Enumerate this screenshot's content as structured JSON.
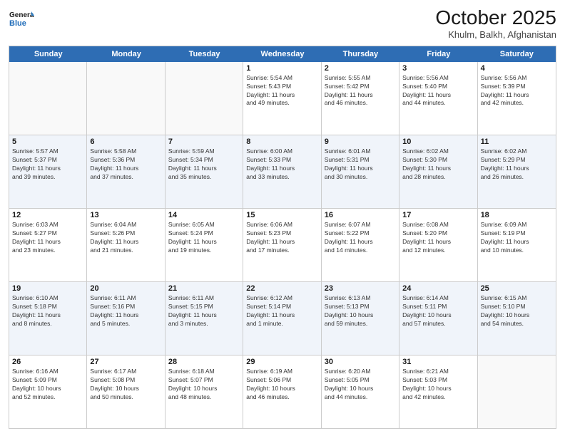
{
  "header": {
    "logo_line1": "General",
    "logo_line2": "Blue",
    "month_title": "October 2025",
    "location": "Khulm, Balkh, Afghanistan"
  },
  "day_names": [
    "Sunday",
    "Monday",
    "Tuesday",
    "Wednesday",
    "Thursday",
    "Friday",
    "Saturday"
  ],
  "weeks": [
    [
      {
        "num": "",
        "info": ""
      },
      {
        "num": "",
        "info": ""
      },
      {
        "num": "",
        "info": ""
      },
      {
        "num": "1",
        "info": "Sunrise: 5:54 AM\nSunset: 5:43 PM\nDaylight: 11 hours\nand 49 minutes."
      },
      {
        "num": "2",
        "info": "Sunrise: 5:55 AM\nSunset: 5:42 PM\nDaylight: 11 hours\nand 46 minutes."
      },
      {
        "num": "3",
        "info": "Sunrise: 5:56 AM\nSunset: 5:40 PM\nDaylight: 11 hours\nand 44 minutes."
      },
      {
        "num": "4",
        "info": "Sunrise: 5:56 AM\nSunset: 5:39 PM\nDaylight: 11 hours\nand 42 minutes."
      }
    ],
    [
      {
        "num": "5",
        "info": "Sunrise: 5:57 AM\nSunset: 5:37 PM\nDaylight: 11 hours\nand 39 minutes."
      },
      {
        "num": "6",
        "info": "Sunrise: 5:58 AM\nSunset: 5:36 PM\nDaylight: 11 hours\nand 37 minutes."
      },
      {
        "num": "7",
        "info": "Sunrise: 5:59 AM\nSunset: 5:34 PM\nDaylight: 11 hours\nand 35 minutes."
      },
      {
        "num": "8",
        "info": "Sunrise: 6:00 AM\nSunset: 5:33 PM\nDaylight: 11 hours\nand 33 minutes."
      },
      {
        "num": "9",
        "info": "Sunrise: 6:01 AM\nSunset: 5:31 PM\nDaylight: 11 hours\nand 30 minutes."
      },
      {
        "num": "10",
        "info": "Sunrise: 6:02 AM\nSunset: 5:30 PM\nDaylight: 11 hours\nand 28 minutes."
      },
      {
        "num": "11",
        "info": "Sunrise: 6:02 AM\nSunset: 5:29 PM\nDaylight: 11 hours\nand 26 minutes."
      }
    ],
    [
      {
        "num": "12",
        "info": "Sunrise: 6:03 AM\nSunset: 5:27 PM\nDaylight: 11 hours\nand 23 minutes."
      },
      {
        "num": "13",
        "info": "Sunrise: 6:04 AM\nSunset: 5:26 PM\nDaylight: 11 hours\nand 21 minutes."
      },
      {
        "num": "14",
        "info": "Sunrise: 6:05 AM\nSunset: 5:24 PM\nDaylight: 11 hours\nand 19 minutes."
      },
      {
        "num": "15",
        "info": "Sunrise: 6:06 AM\nSunset: 5:23 PM\nDaylight: 11 hours\nand 17 minutes."
      },
      {
        "num": "16",
        "info": "Sunrise: 6:07 AM\nSunset: 5:22 PM\nDaylight: 11 hours\nand 14 minutes."
      },
      {
        "num": "17",
        "info": "Sunrise: 6:08 AM\nSunset: 5:20 PM\nDaylight: 11 hours\nand 12 minutes."
      },
      {
        "num": "18",
        "info": "Sunrise: 6:09 AM\nSunset: 5:19 PM\nDaylight: 11 hours\nand 10 minutes."
      }
    ],
    [
      {
        "num": "19",
        "info": "Sunrise: 6:10 AM\nSunset: 5:18 PM\nDaylight: 11 hours\nand 8 minutes."
      },
      {
        "num": "20",
        "info": "Sunrise: 6:11 AM\nSunset: 5:16 PM\nDaylight: 11 hours\nand 5 minutes."
      },
      {
        "num": "21",
        "info": "Sunrise: 6:11 AM\nSunset: 5:15 PM\nDaylight: 11 hours\nand 3 minutes."
      },
      {
        "num": "22",
        "info": "Sunrise: 6:12 AM\nSunset: 5:14 PM\nDaylight: 11 hours\nand 1 minute."
      },
      {
        "num": "23",
        "info": "Sunrise: 6:13 AM\nSunset: 5:13 PM\nDaylight: 10 hours\nand 59 minutes."
      },
      {
        "num": "24",
        "info": "Sunrise: 6:14 AM\nSunset: 5:11 PM\nDaylight: 10 hours\nand 57 minutes."
      },
      {
        "num": "25",
        "info": "Sunrise: 6:15 AM\nSunset: 5:10 PM\nDaylight: 10 hours\nand 54 minutes."
      }
    ],
    [
      {
        "num": "26",
        "info": "Sunrise: 6:16 AM\nSunset: 5:09 PM\nDaylight: 10 hours\nand 52 minutes."
      },
      {
        "num": "27",
        "info": "Sunrise: 6:17 AM\nSunset: 5:08 PM\nDaylight: 10 hours\nand 50 minutes."
      },
      {
        "num": "28",
        "info": "Sunrise: 6:18 AM\nSunset: 5:07 PM\nDaylight: 10 hours\nand 48 minutes."
      },
      {
        "num": "29",
        "info": "Sunrise: 6:19 AM\nSunset: 5:06 PM\nDaylight: 10 hours\nand 46 minutes."
      },
      {
        "num": "30",
        "info": "Sunrise: 6:20 AM\nSunset: 5:05 PM\nDaylight: 10 hours\nand 44 minutes."
      },
      {
        "num": "31",
        "info": "Sunrise: 6:21 AM\nSunset: 5:03 PM\nDaylight: 10 hours\nand 42 minutes."
      },
      {
        "num": "",
        "info": ""
      }
    ]
  ]
}
